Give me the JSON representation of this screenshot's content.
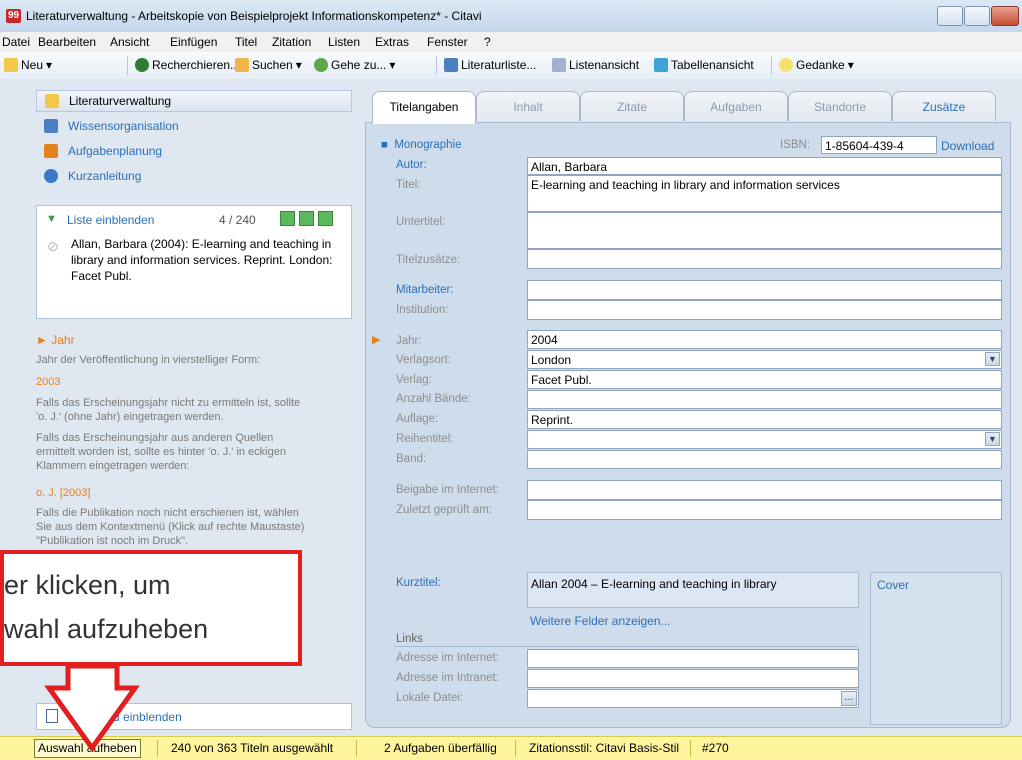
{
  "window": {
    "title": "Literaturverwaltung - Arbeitskopie von Beispielprojekt Informationskompetenz* - Citavi",
    "app_icon": "99"
  },
  "menu": [
    "Datei",
    "Bearbeiten",
    "Ansicht",
    "Einfügen",
    "Titel",
    "Zitation",
    "Listen",
    "Extras",
    "Fenster",
    "?"
  ],
  "toolbar": {
    "new": "Neu",
    "research": "Recherchieren...",
    "search": "Suchen",
    "goto": "Gehe zu...",
    "list": "Literaturliste...",
    "listview": "Listenansicht",
    "tableview": "Tabellenansicht",
    "thought": "Gedanke"
  },
  "nav": {
    "items": [
      "Literaturverwaltung",
      "Wissensorganisation",
      "Aufgabenplanung",
      "Kurzanleitung"
    ],
    "list_toggle": "Liste einblenden",
    "list_counter": "4 / 240",
    "record_summary": "Allan, Barbara (2004): E-learning and teaching in library and information services. Reprint. London: Facet Publ.",
    "footer_toggle": "Notizfeld einblenden"
  },
  "help": {
    "title": "Jahr",
    "p1": "Jahr der Veröffentlichung in vierstelliger Form:",
    "ex1": "2003",
    "p2a": "Falls das Erscheinungsjahr nicht zu ermitteln ist, sollte",
    "p2b": "'o. J.' (ohne Jahr) eingetragen werden.",
    "p3a": "Falls das Erscheinungsjahr aus anderen Quellen",
    "p3b": "ermittelt worden ist, sollte es hinter 'o. J.' in eckigen",
    "p3c": "Klammern eingetragen werden:",
    "ex2": "o. J. [2003]",
    "p4a": "Falls die Publikation noch nicht erschienen ist, wählen",
    "p4b": "Sie aus dem Kontextmenü (Klick auf rechte Maustaste)",
    "p4c": "\"Publikation ist noch im Druck\"."
  },
  "tabs": [
    "Titelangaben",
    "Inhalt",
    "Zitate",
    "Aufgaben",
    "Standorte",
    "Zusätze"
  ],
  "form": {
    "type": "Monographie",
    "isbn_label": "ISBN:",
    "isbn": "1-85604-439-4",
    "download": "Download",
    "author_label": "Autor:",
    "author": "Allan, Barbara",
    "title_label": "Titel:",
    "title": "E-learning and teaching in library and information services",
    "subtitle_label": "Untertitel:",
    "subtitle": "",
    "titleadd_label": "Titelzusätze:",
    "titleadd": "",
    "contributors_label": "Mitarbeiter:",
    "contributors": "",
    "institution_label": "Institution:",
    "institution": "",
    "year_label": "Jahr:",
    "year": "2004",
    "place_label": "Verlagsort:",
    "place": "London",
    "publisher_label": "Verlag:",
    "publisher": "Facet Publ.",
    "volumes_label": "Anzahl Bände:",
    "volumes": "",
    "edition_label": "Auflage:",
    "edition": "Reprint.",
    "series_label": "Reihentitel:",
    "series": "",
    "band_label": "Band:",
    "band": "",
    "online_label": "Beigabe im Internet:",
    "online": "",
    "checked_label": "Zuletzt geprüft am:",
    "checked": "",
    "shorttitle_label": "Kurztitel:",
    "shorttitle": "Allan 2004 – E-learning and teaching in library",
    "more_fields": "Weitere Felder anzeigen...",
    "cover": "Cover",
    "links_heading": "Links",
    "internet_label": "Adresse im Internet:",
    "internet": "",
    "intranet_label": "Adresse im Intranet:",
    "intranet": "",
    "localfile_label": "Lokale Datei:",
    "localfile": "",
    "browse": "..."
  },
  "status": {
    "deselect": "Auswahl aufheben",
    "selected": "240 von 363 Titeln ausgewählt",
    "tasks": "2 Aufgaben überfällig",
    "style": "Zitationsstil: Citavi Basis-Stil",
    "number": "#270"
  },
  "callout": {
    "line1": "er klicken, um",
    "line2": "wahl aufzuheben"
  }
}
